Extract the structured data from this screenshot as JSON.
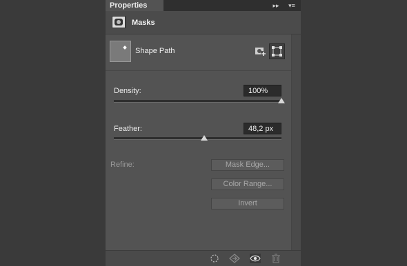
{
  "panel": {
    "tab_title": "Properties"
  },
  "header": {
    "title": "Masks",
    "icon": "mask-icon"
  },
  "shape": {
    "label": "Shape Path"
  },
  "density": {
    "label": "Density:",
    "value": "100%",
    "percent": 100
  },
  "feather": {
    "label": "Feather:",
    "value": "48,2 px",
    "percent": 54
  },
  "refine": {
    "label": "Refine:",
    "buttons": [
      "Mask Edge...",
      "Color Range...",
      "Invert"
    ]
  },
  "footer": {
    "icons": [
      "load-selection-icon",
      "apply-mask-icon",
      "visibility-icon",
      "delete-icon"
    ]
  }
}
